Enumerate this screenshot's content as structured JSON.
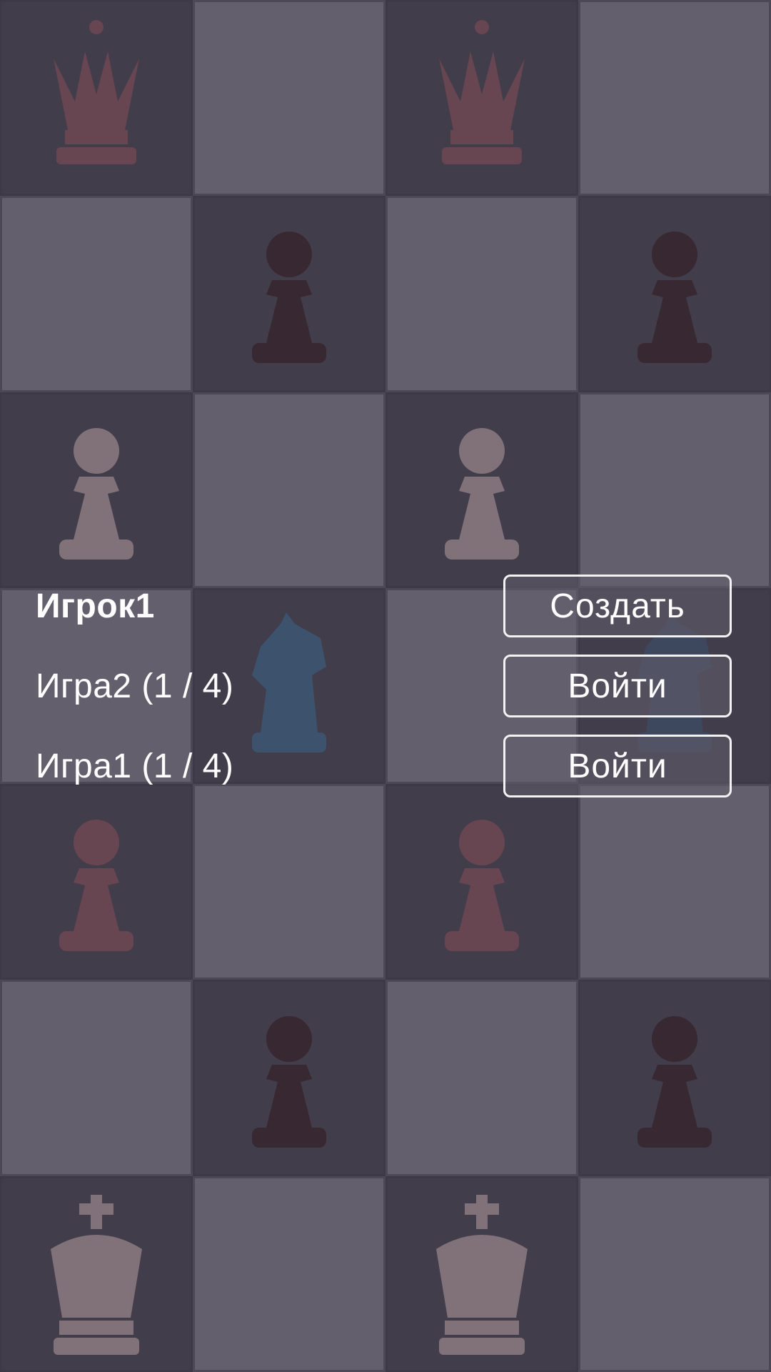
{
  "player": {
    "name": "Игрок1"
  },
  "actions": {
    "create_label": "Создать"
  },
  "games": [
    {
      "label": "Игра2 (1 / 4)",
      "join_label": "Войти"
    },
    {
      "label": "Игра1 (1 / 4)",
      "join_label": "Войти"
    }
  ],
  "board": {
    "colors": {
      "dark": "#45404f",
      "light": "#6a6574",
      "piece_light": "#8a7a80",
      "piece_dark": "#3b2a32",
      "piece_red": "#6e4a55",
      "piece_blue": "#3f5773"
    },
    "pieces_icons": [
      "queen-icon",
      "pawn-icon",
      "knight-icon",
      "king-icon"
    ]
  }
}
